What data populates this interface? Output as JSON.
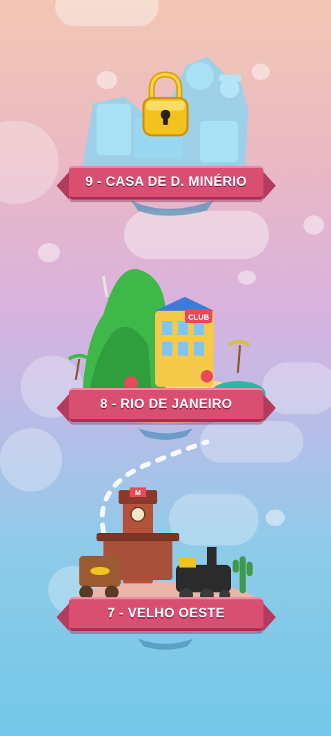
{
  "levels": [
    {
      "number": 9,
      "label": "9 - CASA DE D. MINÉRIO",
      "locked": true,
      "lock_icon": "padlock-icon"
    },
    {
      "number": 8,
      "label": "8 - RIO DE JANEIRO",
      "locked": false,
      "sign_text": "CLUB"
    },
    {
      "number": 7,
      "label": "7 - VELHO OESTE",
      "locked": false,
      "sign_text": "M"
    }
  ],
  "colors": {
    "banner": "#d94f72",
    "lock_gold": "#f2c21d",
    "locked_island": "#8fd3ee",
    "hill_green": "#3fb84a",
    "sand": "#f6d98a"
  }
}
